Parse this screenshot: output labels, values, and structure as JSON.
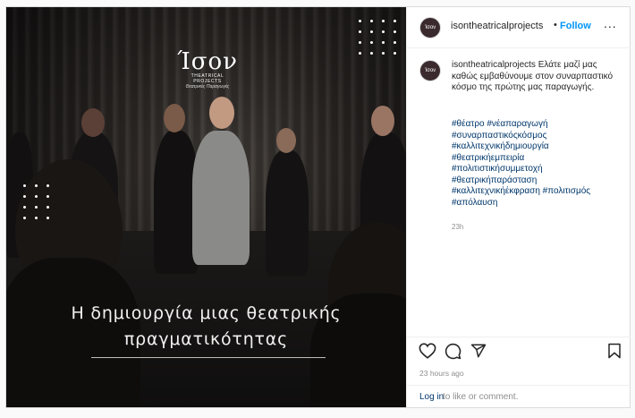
{
  "post": {
    "image": {
      "logo_text": "Ίσον",
      "logo_subtitle": "THEATRICAL PROJECTS",
      "logo_subtitle2": "Θεατρικές Παραγωγές",
      "caption_line1": "Η δημιουργία μιας θεατρικής",
      "caption_line2": "πραγματικότητας"
    },
    "header": {
      "avatar_text": "Ίσον",
      "username": "isontheatricalprojects",
      "separator": "•",
      "follow_label": "Follow",
      "more_label": "..."
    },
    "caption": {
      "username": "isontheatricalprojects",
      "text": "Ελάτε μαζί μας καθώς εμβαθύνουμε στον συναρπαστικό κόσμο της πρώτης μας παραγωγής.",
      "hashtags": [
        "#θέατρο #νέαπαραγωγή",
        "#συναρπαστικόςκόσμος",
        "#καλλιτεχνικήδημιουργία",
        "#θεατρικήεμπειρία",
        "#πολιτιστικήσυμμετοχή",
        "#θεατρικήπαράσταση",
        "#καλλιτεχνικήέκφραση #πολιτισμός",
        "#απόλαυση"
      ],
      "time": "23h"
    },
    "actions": {
      "icons": [
        "heart-icon",
        "comment-icon",
        "share-icon",
        "bookmark-icon"
      ]
    },
    "posted_ago": "23 hours ago",
    "login": {
      "link": "Log in",
      "rest": "to like or comment."
    }
  },
  "colors": {
    "link_blue": "#0095f6",
    "hashtag_blue": "#00376b",
    "muted_gray": "#8e8e8e"
  }
}
